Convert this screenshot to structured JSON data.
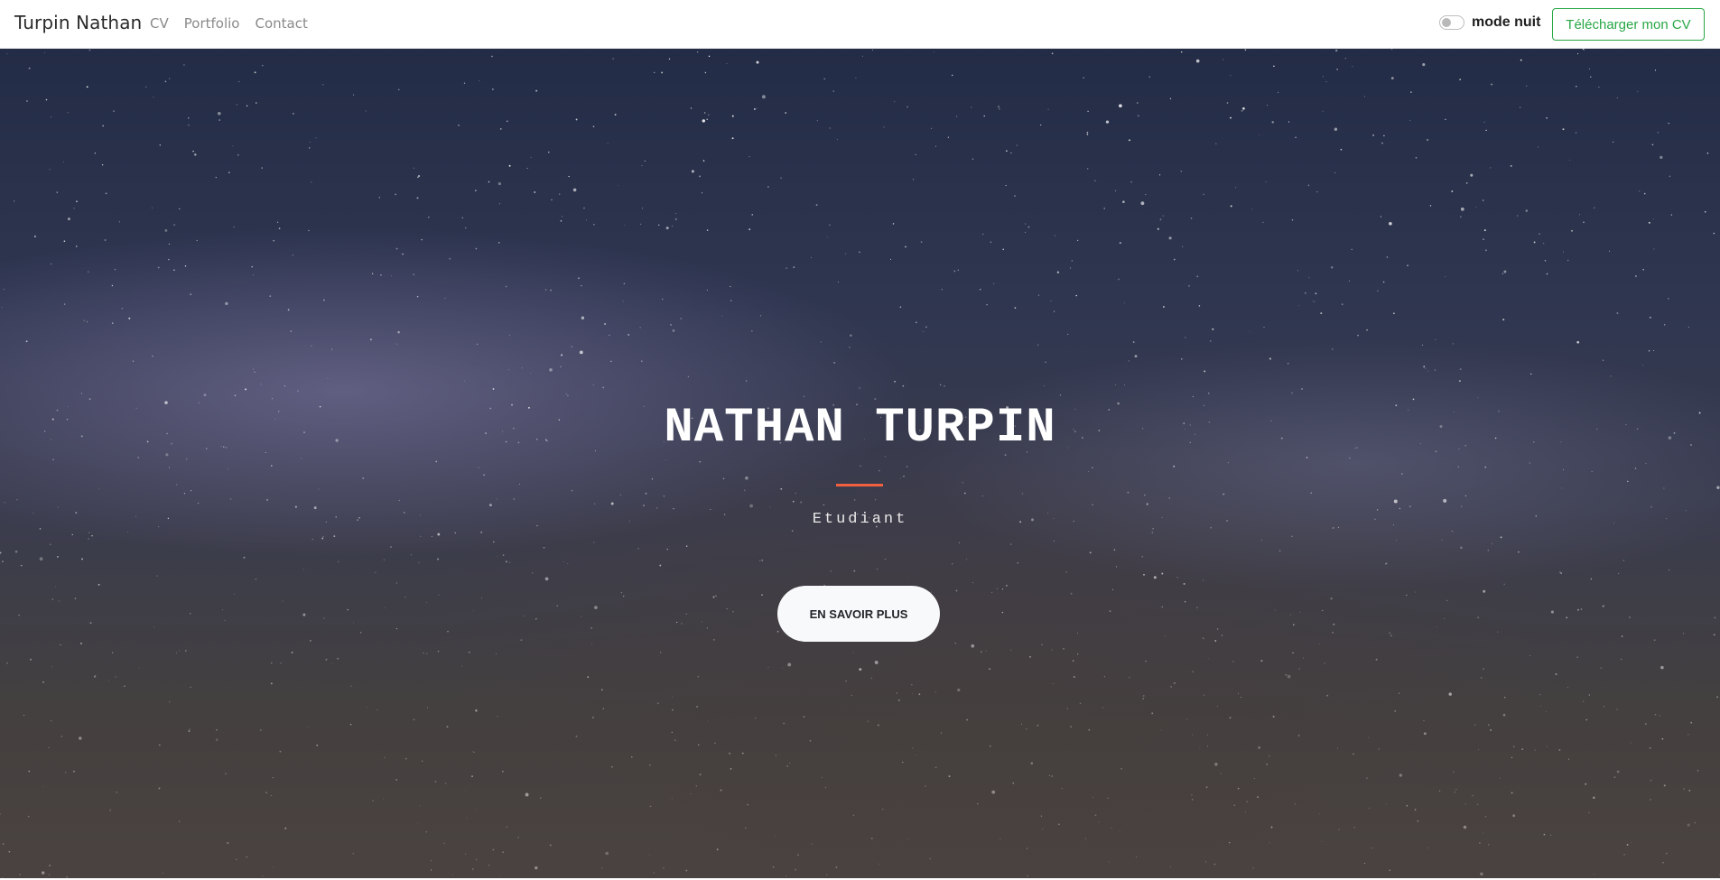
{
  "navbar": {
    "brand": "Turpin Nathan",
    "links": [
      {
        "label": "CV"
      },
      {
        "label": "Portfolio"
      },
      {
        "label": "Contact"
      }
    ],
    "night_mode": {
      "label": "mode nuit",
      "enabled": false
    },
    "cv_button_label": "Télécharger mon CV"
  },
  "hero": {
    "title": "NATHAN TURPIN",
    "subtitle": "Etudiant",
    "cta_label": "EN SAVOIR PLUS"
  },
  "colors": {
    "accent_green": "#28a745",
    "accent_orange": "#f05f40",
    "hero_text": "#ffffff"
  }
}
